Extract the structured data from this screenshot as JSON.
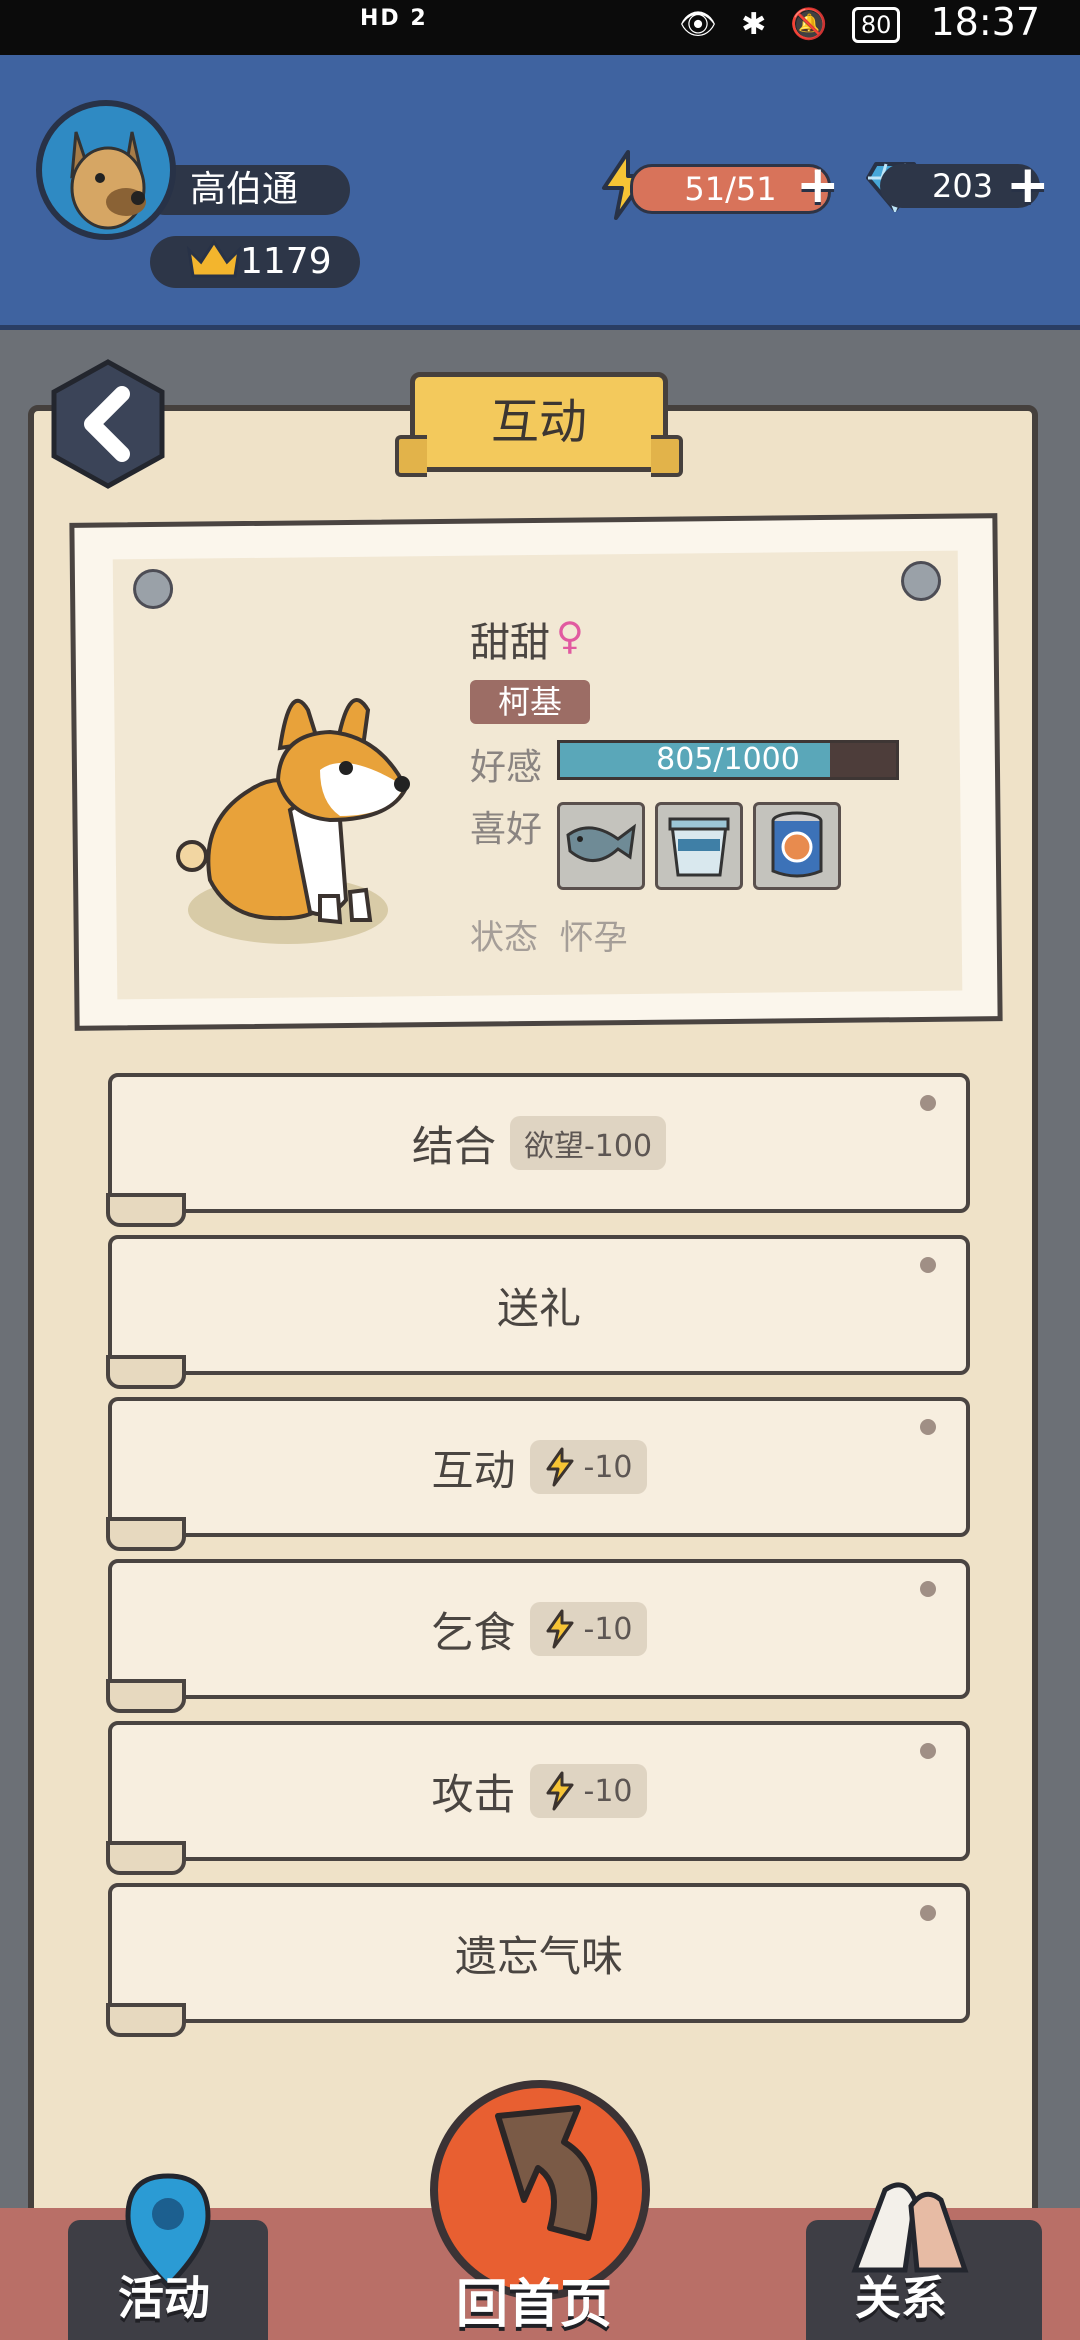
{
  "status_bar": {
    "left_text": "HD 2",
    "time": "18:37",
    "battery": "80"
  },
  "player": {
    "name": "高伯通",
    "score": "1179"
  },
  "resources": {
    "energy": "51/51",
    "gems": "203"
  },
  "page": {
    "title": "互动"
  },
  "pet": {
    "name": "甜甜",
    "gender_symbol": "♀",
    "breed": "柯基",
    "affinity_label": "好感",
    "affinity_text": "805/1000",
    "affinity_fraction": 0.805,
    "likes_label": "喜好",
    "likes": [
      "fish-item",
      "yogurt-item",
      "canned-food-item"
    ],
    "state_label": "状态",
    "state_value": "怀孕"
  },
  "actions": [
    {
      "label": "结合",
      "cost": "欲望-100",
      "cost_icon": ""
    },
    {
      "label": "送礼",
      "cost": "",
      "cost_icon": ""
    },
    {
      "label": "互动",
      "cost": "-10",
      "cost_icon": "lightning-icon"
    },
    {
      "label": "乞食",
      "cost": "-10",
      "cost_icon": "lightning-icon"
    },
    {
      "label": "攻击",
      "cost": "-10",
      "cost_icon": "lightning-icon"
    },
    {
      "label": "遗忘气味",
      "cost": "",
      "cost_icon": ""
    }
  ],
  "nav": {
    "activity": "活动",
    "home": "回首页",
    "relations": "关系"
  },
  "colors": {
    "top_bar": "#3f63a0",
    "paper": "#efe2c8",
    "affinity_bar": "#5aa7b9",
    "energy": "#d8735a",
    "breed_tag": "#9c6d65"
  }
}
